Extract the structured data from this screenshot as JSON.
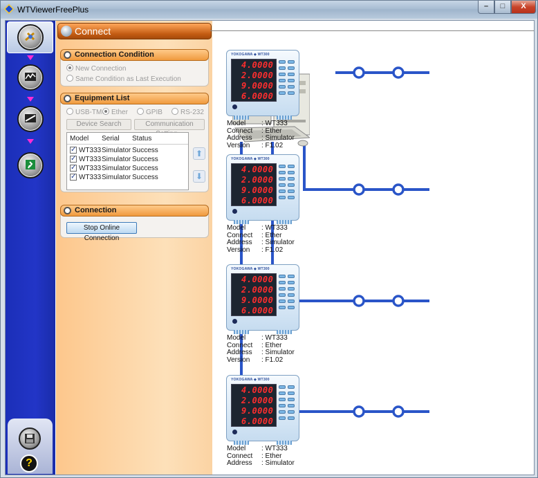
{
  "window": {
    "title": "WTViewerFreePlus",
    "min": "–",
    "max": "□",
    "close": "X"
  },
  "page": {
    "title": "Connect"
  },
  "condition": {
    "title": "Connection Condition",
    "options": [
      "New Connection",
      "Same Condition as Last Execution"
    ]
  },
  "equipment": {
    "title": "Equipment List",
    "interfaces": [
      "USB-TMC",
      "Ether",
      "GPIB",
      "RS-232"
    ],
    "search_label": "Device Search",
    "comm_label": "Communication Setting...",
    "columns": [
      "Model",
      "Serial",
      "Status"
    ],
    "rows": [
      {
        "model": "WT333",
        "serial": "Simulator",
        "status": "Success"
      },
      {
        "model": "WT333",
        "serial": "Simulator",
        "status": "Success"
      },
      {
        "model": "WT333",
        "serial": "Simulator",
        "status": "Success"
      },
      {
        "model": "WT333",
        "serial": "Simulator",
        "status": "Success"
      }
    ],
    "up_icon": "arrow-up-icon",
    "down_icon": "arrow-down-icon"
  },
  "connection": {
    "title": "Connection",
    "stop_label": "Stop Online Connection"
  },
  "devices": [
    {
      "brand": "YOKOGAWA ◆ WT300",
      "readings": [
        "4.0000",
        "2.0000",
        "9.0000",
        "6.0000"
      ],
      "labels": [
        "Model",
        "Connect",
        "Address",
        "Version"
      ],
      "values": [
        ": WT333",
        ": Ether",
        ": Simulator",
        ": F1.02"
      ]
    },
    {
      "brand": "YOKOGAWA ◆ WT300",
      "readings": [
        "4.0000",
        "2.0000",
        "9.0000",
        "6.0000"
      ],
      "labels": [
        "Model",
        "Connect",
        "Address",
        "Version"
      ],
      "values": [
        ": WT333",
        ": Ether",
        ": Simulator",
        ": F1.02"
      ]
    },
    {
      "brand": "YOKOGAWA ◆ WT300",
      "readings": [
        "4.0000",
        "2.0000",
        "9.0000",
        "6.0000"
      ],
      "labels": [
        "Model",
        "Connect",
        "Address",
        "Version"
      ],
      "values": [
        ": WT333",
        ": Ether",
        ": Simulator",
        ": F1.02"
      ]
    },
    {
      "brand": "YOKOGAWA ◆ WT300",
      "readings": [
        "4.0000",
        "2.0000",
        "9.0000",
        "6.0000"
      ],
      "labels": [
        "Model",
        "Connect",
        "Address"
      ],
      "values": [
        ": WT333",
        ": Ether",
        ": Simulator"
      ]
    }
  ],
  "colors": {
    "nav": "#2235c7",
    "accent": "#f09a3e",
    "link": "#2a55c8",
    "display": "#ff2e2e"
  },
  "help": "?"
}
